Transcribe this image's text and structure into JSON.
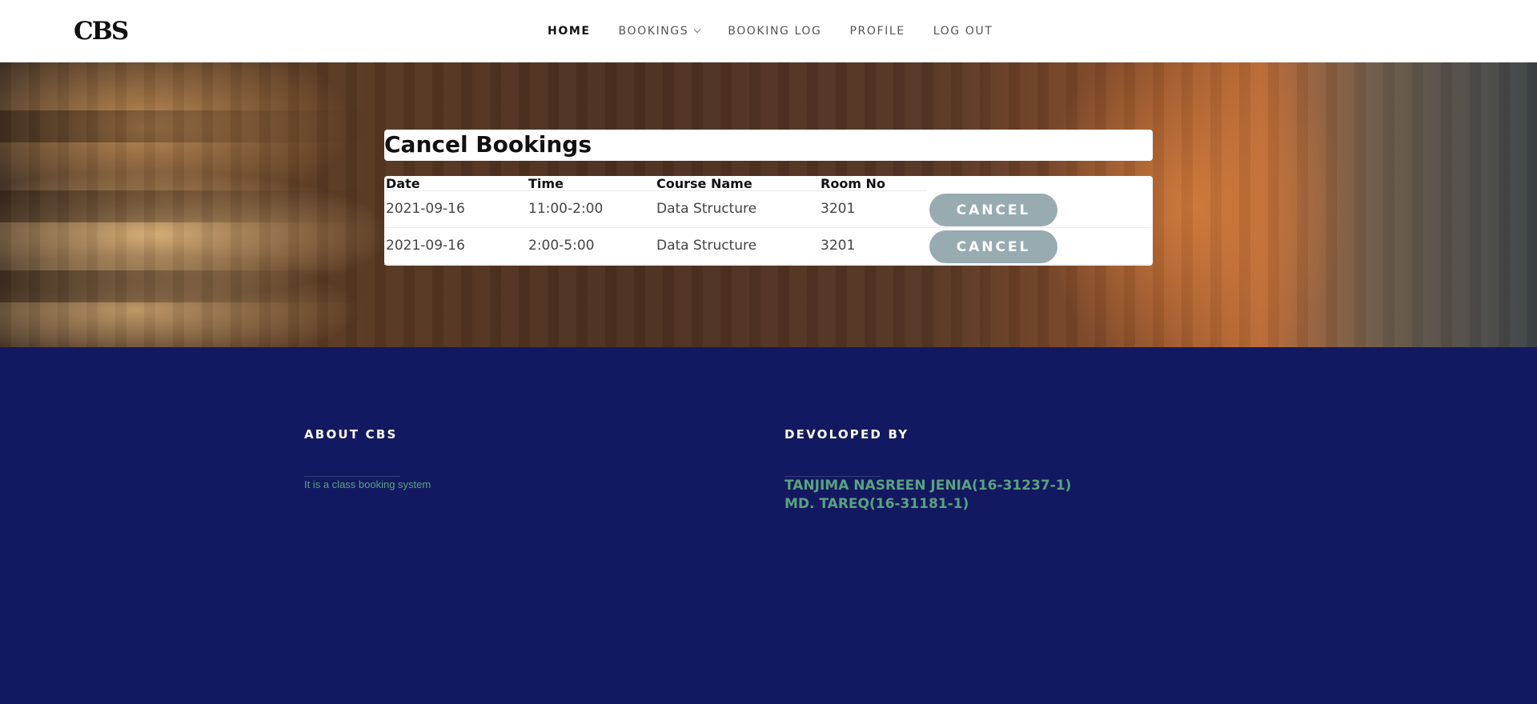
{
  "header": {
    "logo": "CBS",
    "nav": [
      {
        "label": "HOME",
        "active": true
      },
      {
        "label": "BOOKINGS",
        "has_dropdown": true
      },
      {
        "label": "BOOKING LOG"
      },
      {
        "label": "PROFILE"
      },
      {
        "label": "LOG OUT"
      }
    ]
  },
  "page": {
    "title": "Cancel Bookings"
  },
  "table": {
    "columns": [
      "Date",
      "Time",
      "Course Name",
      "Room No"
    ],
    "rows": [
      {
        "date": "2021-09-16",
        "time": "11:00-2:00",
        "course": "Data Structure",
        "room": "3201",
        "action": "CANCEL"
      },
      {
        "date": "2021-09-16",
        "time": "2:00-5:00",
        "course": "Data Structure",
        "room": "3201",
        "action": "CANCEL"
      }
    ]
  },
  "footer": {
    "about_heading": "ABOUT CBS",
    "about_text": "It is a class booking system",
    "dev_heading": "DEVOLOPED BY",
    "developers": [
      "TANJIMA NASREEN JENIA(16-31237-1)",
      "MD. TAREQ(16-31181-1)"
    ]
  },
  "colors": {
    "footer_bg": "#131960",
    "accent_green": "#5aa37e",
    "cancel_button": "#97abb1"
  },
  "icons": {
    "bookings_dropdown": "chevron-down-icon"
  }
}
